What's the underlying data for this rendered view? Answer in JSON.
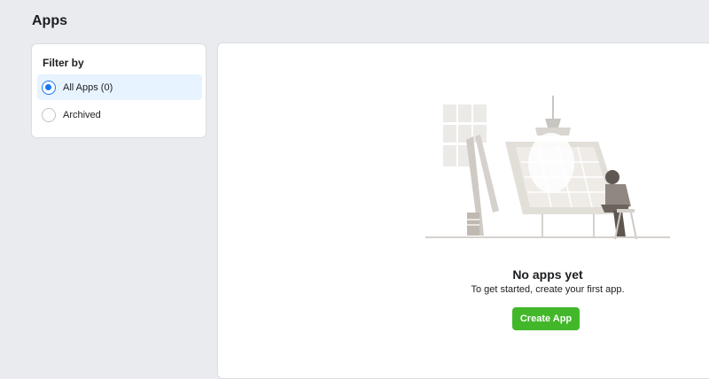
{
  "page": {
    "title": "Apps"
  },
  "filter": {
    "title": "Filter by",
    "options": [
      {
        "label": "All Apps (0)",
        "selected": true
      },
      {
        "label": "Archived",
        "selected": false
      }
    ]
  },
  "empty_state": {
    "title": "No apps yet",
    "subtitle": "To get started, create your first app.",
    "button_label": "Create App"
  },
  "colors": {
    "background": "#e9ebee",
    "accent": "#1877f2",
    "button": "#42b72a",
    "selected_bg": "#e7f3ff"
  }
}
